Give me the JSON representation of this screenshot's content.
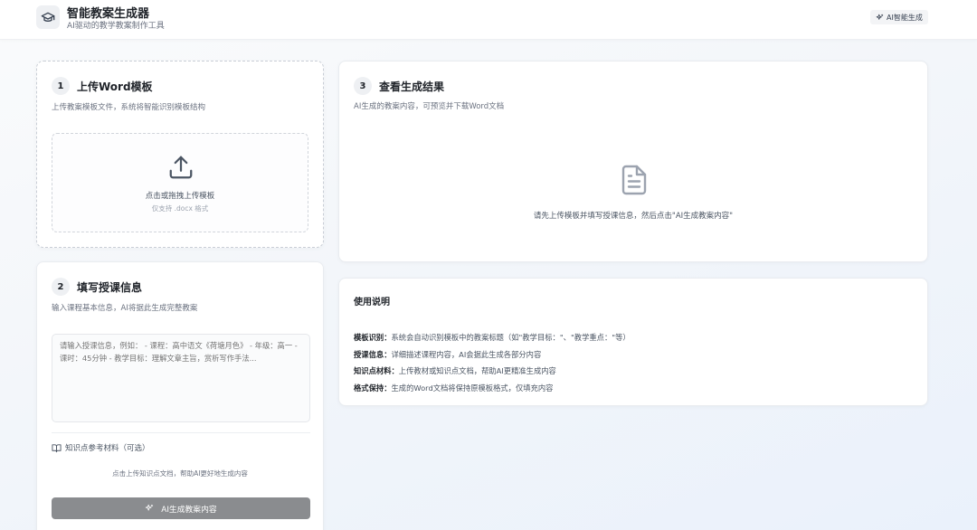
{
  "header": {
    "logo_icon": "graduation-cap-icon",
    "title": "智能教案生成器",
    "subtitle": "AI驱动的教学教案制作工具",
    "badge_icon": "sparkles-icon",
    "badge_label": "AI智能生成"
  },
  "step1": {
    "number": "1",
    "title": "上传Word模板",
    "description": "上传教案模板文件，系统将智能识别模板结构",
    "upload_icon": "upload-icon",
    "upload_text": "点击或拖拽上传模板",
    "upload_hint": "仅支持 .docx 格式"
  },
  "step2": {
    "number": "2",
    "title": "填写授课信息",
    "description": "输入课程基本信息，AI将据此生成完整教案",
    "textarea_placeholder": "请输入授课信息，例如： - 课程：高中语文《荷塘月色》 - 年级：高一 - 课时：45分钟 - 教学目标：理解文章主旨，赏析写作手法...",
    "kb_icon": "book-open-icon",
    "kb_label": "知识点参考材料（可选）",
    "kb_upload_text": "点击上传知识点文档，帮助AI更好地生成内容",
    "generate_icon": "sparkles-icon",
    "generate_label": "AI生成教案内容"
  },
  "step3": {
    "number": "3",
    "title": "查看生成结果",
    "description": "AI生成的教案内容，可预览并下载Word文档",
    "empty_icon": "document-icon",
    "empty_text": "请先上传模板并填写授课信息，然后点击\"AI生成教案内容\""
  },
  "usage": {
    "title": "使用说明",
    "items": [
      {
        "term": "模板识别：",
        "text": "系统会自动识别模板中的教案标题（如\"教学目标：\"、\"教学重点：\"等）"
      },
      {
        "term": "授课信息：",
        "text": "详细描述课程内容，AI会据此生成各部分内容"
      },
      {
        "term": "知识点材料：",
        "text": "上传教材或知识点文档，帮助AI更精准生成内容"
      },
      {
        "term": "格式保持：",
        "text": "生成的Word文档将保持原模板格式，仅填充内容"
      }
    ]
  },
  "colors": {
    "primary_text": "#1f2329",
    "muted_text": "#6b7280",
    "button_disabled": "#8a8c8f",
    "card_border": "#e9ecf0"
  }
}
